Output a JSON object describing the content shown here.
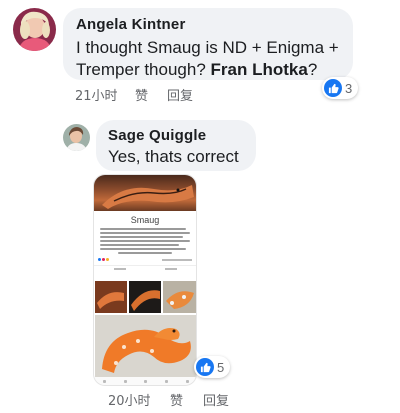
{
  "comments": [
    {
      "author": "Angela Kintner",
      "text": "I thought Smaug is ND + Enigma + Tremper though?",
      "mention": "Fran Lhotka",
      "text_end": "?",
      "time": "21小时",
      "like_label": "赞",
      "reply_label": "回复",
      "reaction_count": "3"
    },
    {
      "author": "Sage Quiggle",
      "text": "Yes, thats correct",
      "time": "20小时",
      "like_label": "赞",
      "reply_label": "回复",
      "reaction_count": "5"
    }
  ],
  "attachment": {
    "title": "Smaug"
  },
  "colors": {
    "bubble": "#f0f2f5",
    "like_blue": "#1877f2",
    "meta_gray": "#65676b"
  }
}
